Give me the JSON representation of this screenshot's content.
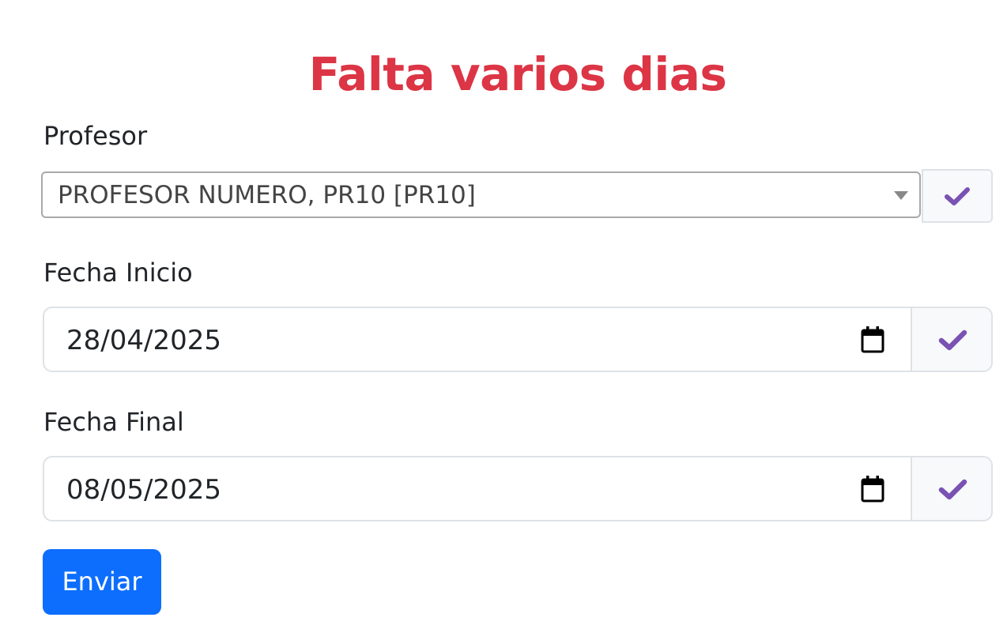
{
  "page": {
    "title": "Falta varios dias"
  },
  "form": {
    "profesor": {
      "label": "Profesor",
      "selected_value": "PROFESOR NUMERO, PR10 [PR10]",
      "valid_icon": "check-icon"
    },
    "fecha_inicio": {
      "label": "Fecha Inicio",
      "value": "28/04/2025",
      "picker_icon": "calendar-icon",
      "valid_icon": "check-icon"
    },
    "fecha_final": {
      "label": "Fecha Final",
      "value": "08/05/2025",
      "picker_icon": "calendar-icon",
      "valid_icon": "check-icon"
    },
    "submit_label": "Enviar"
  },
  "colors": {
    "title": "#dc3545",
    "check": "#7952b3",
    "primary_button": "#0d6efd"
  }
}
